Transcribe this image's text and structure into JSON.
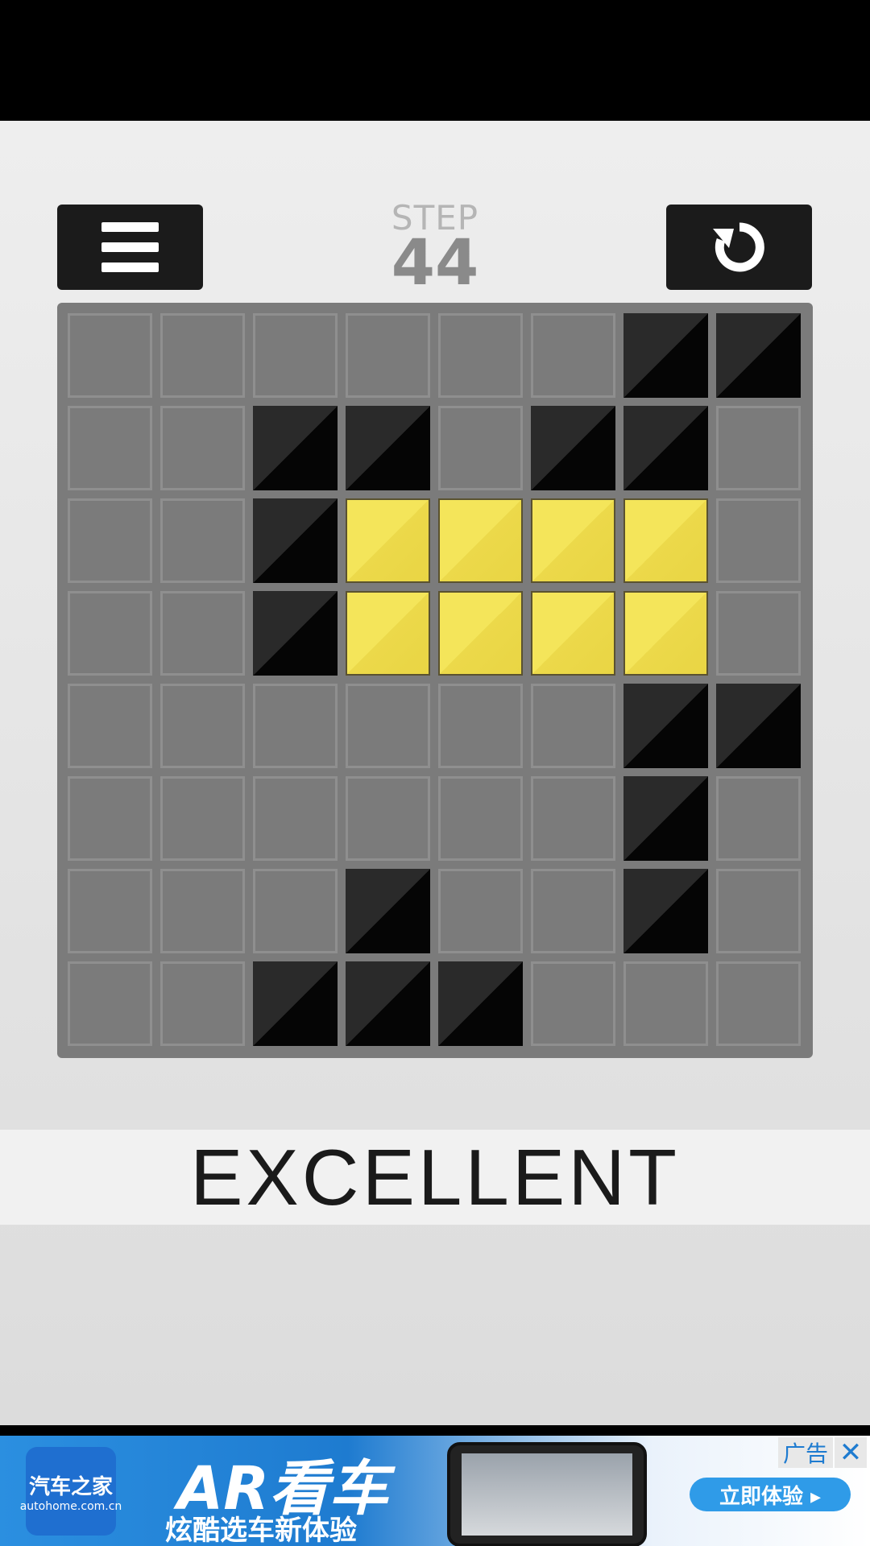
{
  "header": {
    "step_label": "STEP",
    "step_value": "44"
  },
  "icons": {
    "menu": "hamburger-icon",
    "reset": "reset-icon"
  },
  "board": {
    "rows": 8,
    "cols": 8,
    "legend": {
      "0": "empty",
      "1": "black",
      "2": "yellow"
    },
    "grid": [
      [
        0,
        0,
        0,
        0,
        0,
        0,
        1,
        1
      ],
      [
        0,
        0,
        1,
        1,
        0,
        1,
        1,
        0
      ],
      [
        0,
        0,
        1,
        2,
        2,
        2,
        2,
        0
      ],
      [
        0,
        0,
        1,
        2,
        2,
        2,
        2,
        0
      ],
      [
        0,
        0,
        0,
        0,
        0,
        0,
        1,
        1
      ],
      [
        0,
        0,
        0,
        0,
        0,
        0,
        1,
        0
      ],
      [
        0,
        0,
        0,
        1,
        0,
        0,
        1,
        0
      ],
      [
        0,
        0,
        1,
        1,
        1,
        0,
        0,
        0
      ]
    ]
  },
  "result": {
    "text": "EXCELLENT"
  },
  "ad": {
    "logo_name": "汽车之家",
    "logo_sub": "autohome.com.cn",
    "headline": "AR看车",
    "subline": "炫酷选车新体验",
    "cta": "立即体验 ▸",
    "tag": "广告",
    "close": "✕"
  }
}
